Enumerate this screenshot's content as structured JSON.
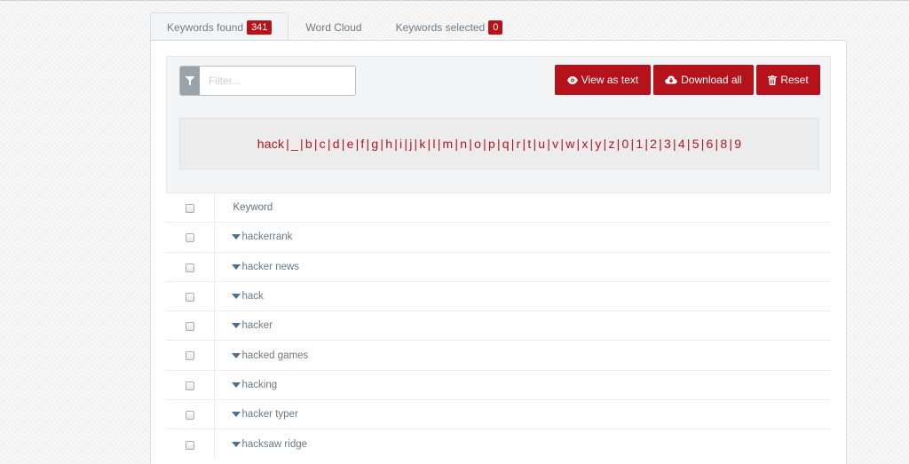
{
  "tabs": [
    {
      "label": "Keywords found",
      "badge": "341",
      "active": true
    },
    {
      "label": "Word Cloud",
      "active": false
    },
    {
      "label": "Keywords selected",
      "badge": "0",
      "active": false
    }
  ],
  "filter": {
    "placeholder": "Filter..."
  },
  "buttons": {
    "view_as_text": "View as text",
    "download_all": "Download all",
    "reset": "Reset"
  },
  "letters": [
    "hack",
    "_",
    "b",
    "c",
    "d",
    "e",
    "f",
    "g",
    "h",
    "i",
    "j",
    "k",
    "l",
    "m",
    "n",
    "o",
    "p",
    "q",
    "r",
    "t",
    "u",
    "v",
    "w",
    "x",
    "y",
    "z",
    "0",
    "1",
    "2",
    "3",
    "4",
    "5",
    "6",
    "8",
    "9"
  ],
  "table": {
    "header": "Keyword",
    "rows": [
      "hackerrank",
      "hacker news",
      "hack",
      "hacker",
      "hacked games",
      "hacking",
      "hacker typer",
      "hacksaw ridge"
    ]
  },
  "colors": {
    "accent": "#b5121b",
    "filter_addon": "#9aa3aa",
    "caret": "#4c6f8f"
  },
  "icons": {
    "filter": "funnel-icon",
    "view": "eye-icon",
    "download": "cloud-download-icon",
    "reset": "trash-icon",
    "expand": "caret-down-icon"
  }
}
